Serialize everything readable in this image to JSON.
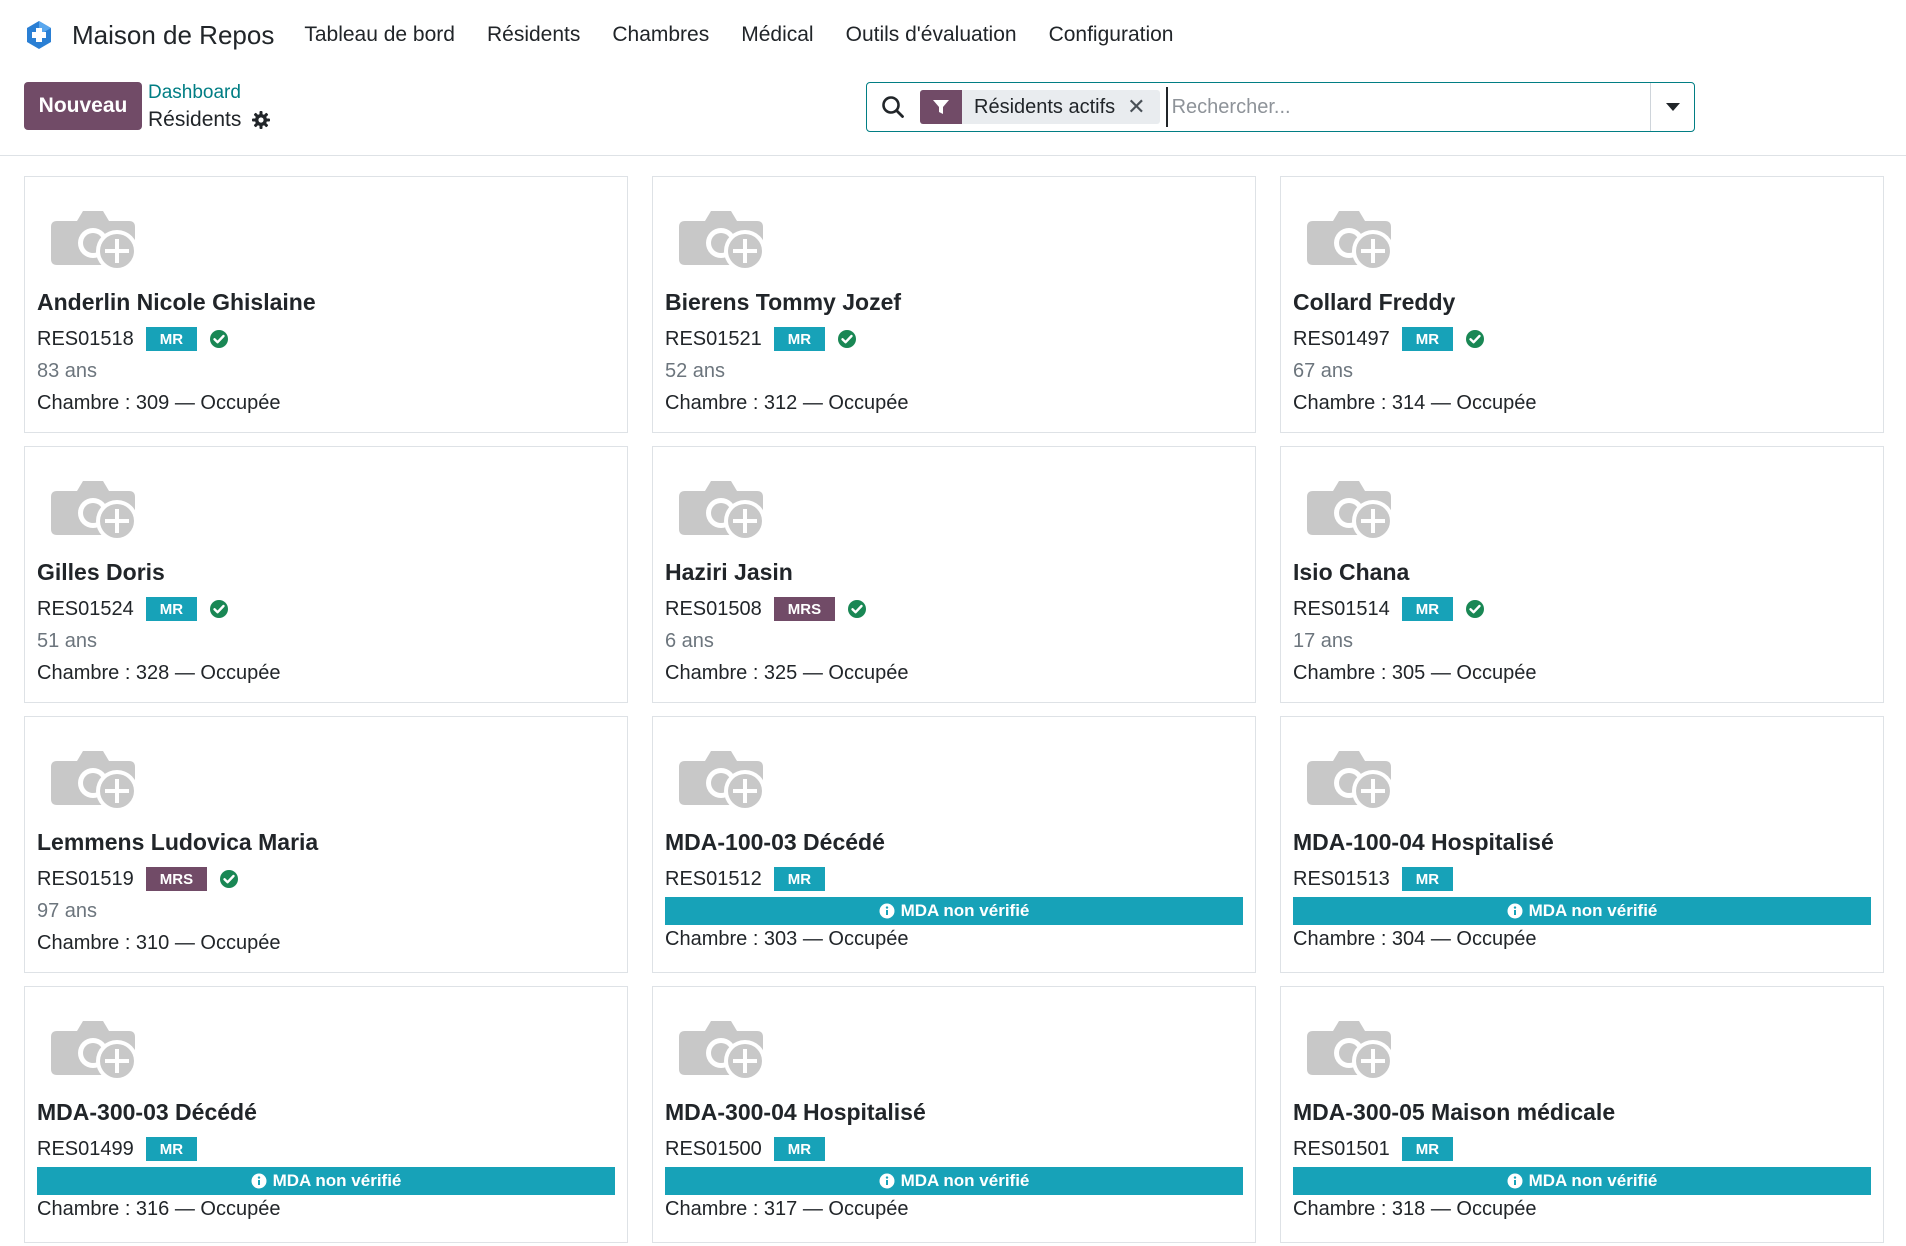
{
  "app": {
    "name": "Maison de Repos"
  },
  "menu": [
    "Tableau de bord",
    "Résidents",
    "Chambres",
    "Médical",
    "Outils d'évaluation",
    "Configuration"
  ],
  "control": {
    "new_label": "Nouveau",
    "breadcrumb_parent": "Dashboard",
    "breadcrumb_current": "Résidents"
  },
  "search": {
    "facet_label": "Résidents actifs",
    "facet_close": "✕",
    "placeholder": "Rechercher..."
  },
  "colors": {
    "brand": "#714B67",
    "teal": "#17a2b8",
    "link": "#017e84",
    "ok": "#198754"
  },
  "residents": [
    {
      "name": "Anderlin Nicole Ghislaine",
      "ref": "RES01518",
      "tag": "MR",
      "status": "verified",
      "age": "83 ans",
      "room": "Chambre : 309 — Occupée"
    },
    {
      "name": "Bierens Tommy Jozef",
      "ref": "RES01521",
      "tag": "MR",
      "status": "verified",
      "age": "52 ans",
      "room": "Chambre : 312 — Occupée"
    },
    {
      "name": "Collard Freddy",
      "ref": "RES01497",
      "tag": "MR",
      "status": "verified",
      "age": "67 ans",
      "room": "Chambre : 314 — Occupée"
    },
    {
      "name": "Gilles Doris",
      "ref": "RES01524",
      "tag": "MR",
      "status": "verified",
      "age": "51 ans",
      "room": "Chambre : 328 — Occupée"
    },
    {
      "name": "Haziri Jasin",
      "ref": "RES01508",
      "tag": "MRS",
      "status": "verified",
      "age": "6 ans",
      "room": "Chambre : 325 — Occupée"
    },
    {
      "name": "Isio Chana",
      "ref": "RES01514",
      "tag": "MR",
      "status": "verified",
      "age": "17 ans",
      "room": "Chambre : 305 — Occupée"
    },
    {
      "name": "Lemmens Ludovica Maria",
      "ref": "RES01519",
      "tag": "MRS",
      "status": "verified",
      "age": "97 ans",
      "room": "Chambre : 310 — Occupée"
    },
    {
      "name": "MDA-100-03 Décédé",
      "ref": "RES01512",
      "tag": "MR",
      "status": "unverified",
      "mda": "MDA non vérifié",
      "room": "Chambre : 303 — Occupée"
    },
    {
      "name": "MDA-100-04 Hospitalisé",
      "ref": "RES01513",
      "tag": "MR",
      "status": "unverified",
      "mda": "MDA non vérifié",
      "room": "Chambre : 304 — Occupée"
    },
    {
      "name": "MDA-300-03 Décédé",
      "ref": "RES01499",
      "tag": "MR",
      "status": "unverified",
      "mda": "MDA non vérifié",
      "room": "Chambre : 316 — Occupée"
    },
    {
      "name": "MDA-300-04 Hospitalisé",
      "ref": "RES01500",
      "tag": "MR",
      "status": "unverified",
      "mda": "MDA non vérifié",
      "room": "Chambre : 317 — Occupée"
    },
    {
      "name": "MDA-300-05 Maison médicale",
      "ref": "RES01501",
      "tag": "MR",
      "status": "unverified",
      "mda": "MDA non vérifié",
      "room": "Chambre : 318 — Occupée"
    }
  ]
}
